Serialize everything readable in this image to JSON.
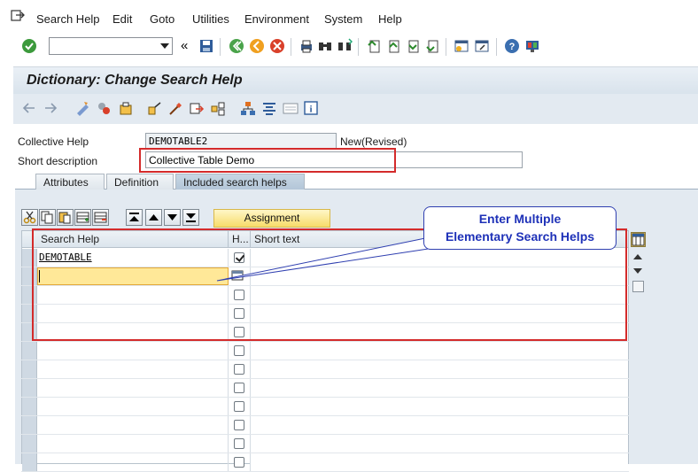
{
  "menu": {
    "items": [
      "Search Help",
      "Edit",
      "Goto",
      "Utilities",
      "Environment",
      "System",
      "Help"
    ]
  },
  "page": {
    "title": "Dictionary: Change Search Help"
  },
  "form": {
    "collective_help_label": "Collective Help",
    "collective_help_value": "DEMOTABLE2",
    "status": "New(Revised)",
    "short_desc_label": "Short description",
    "short_desc_value": "Collective Table Demo"
  },
  "tabs": [
    {
      "label": "Attributes"
    },
    {
      "label": "Definition"
    },
    {
      "label": "Included search helps"
    }
  ],
  "table": {
    "assignment_label": "Assignment",
    "columns": [
      "Search Help",
      "H...",
      "Short text"
    ],
    "rows": [
      {
        "search_help": "DEMOTABLE",
        "checked": true
      },
      {
        "search_help": "",
        "checked": false
      }
    ]
  },
  "callout": {
    "line1": "Enter Multiple",
    "line2": "Elementary Search Helps"
  },
  "colors": {
    "highlight": "#d42b2b",
    "callout_text": "#1e31b8",
    "active_cell": "#ffe898"
  }
}
